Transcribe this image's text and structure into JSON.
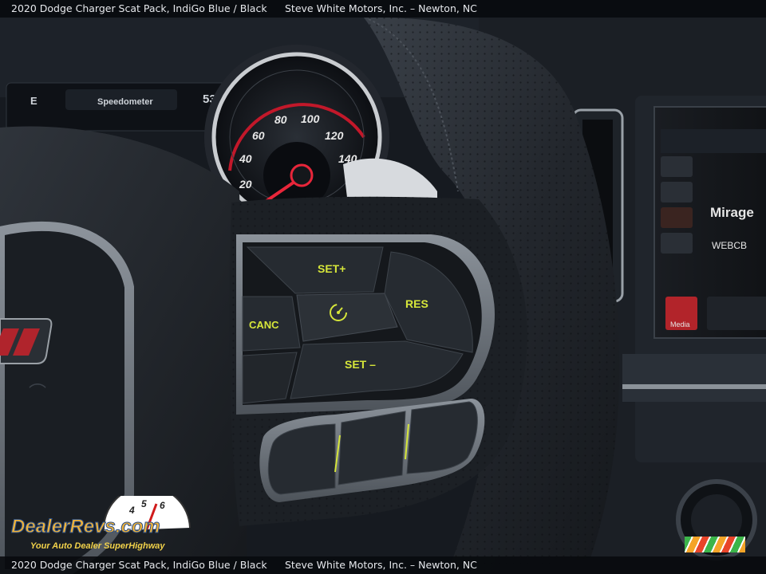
{
  "caption": {
    "vehicle": "2020 Dodge Charger Scat Pack,  IndiGo Blue / Black",
    "dealer": "Steve White Motors, Inc. – Newton, NC"
  },
  "cluster": {
    "title": "Speedometer",
    "outside_temp": "53°",
    "gauge_numbers": [
      "20",
      "40",
      "60",
      "80",
      "100",
      "120",
      "140"
    ]
  },
  "wheel_controls": {
    "set_plus": "SET+",
    "set_minus": "SET –",
    "cancel": "CANC",
    "resume": "RES"
  },
  "infotainment": {
    "mode_button": "Media",
    "brand_text": "Mirage",
    "logo_text": "WEBCB"
  },
  "watermark": {
    "logo": "DealerRevs.com",
    "tagline": "Your Auto Dealer SuperHighway"
  }
}
